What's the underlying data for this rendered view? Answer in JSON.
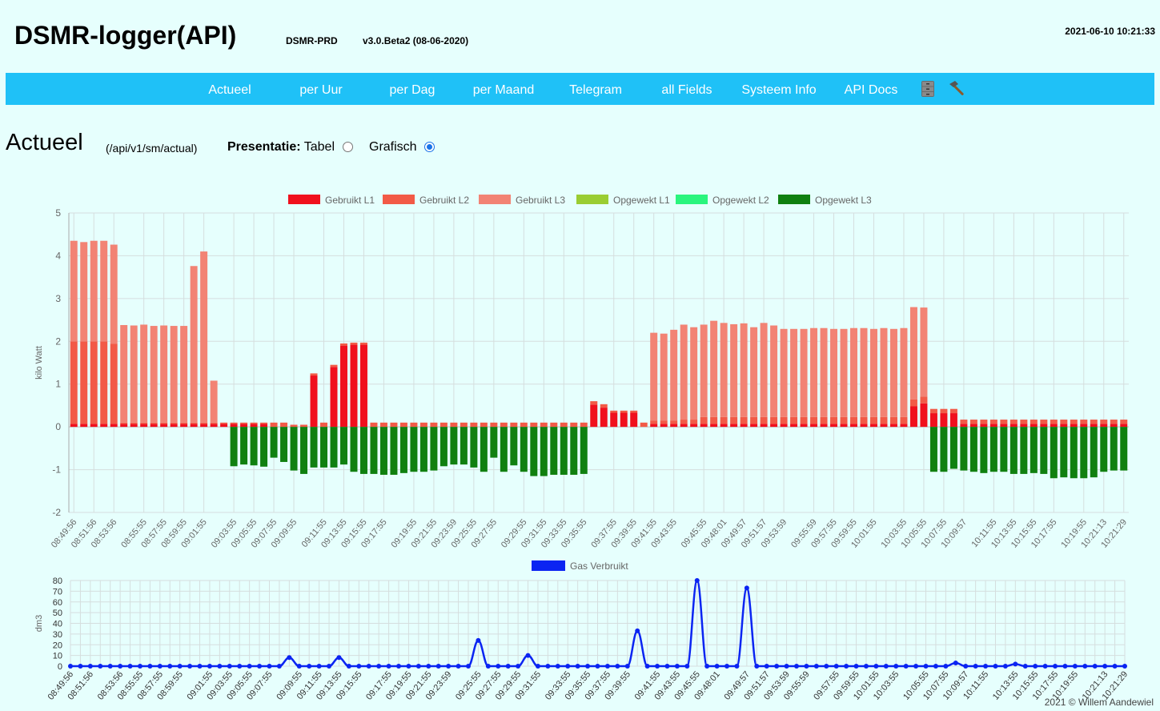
{
  "header": {
    "title": "DSMR-logger(API)",
    "host": "DSMR-PRD",
    "version": "v3.0.Beta2 (08-06-2020)",
    "datetime": "2021-06-10 10:21:33"
  },
  "nav": {
    "items": [
      "Actueel",
      "per Uur",
      "per Dag",
      "per Maand",
      "Telegram",
      "all Fields",
      "Systeem Info",
      "API Docs"
    ],
    "icons": [
      "file-cabinet-icon",
      "hammer-icon"
    ]
  },
  "page": {
    "title": "Actueel",
    "endpoint": "(/api/v1/sm/actual)",
    "presentatie_label": "Presentatie:",
    "option_tabel": "Tabel",
    "option_grafisch": "Grafisch",
    "selected": "Grafisch"
  },
  "colors": {
    "gebruikt_l1": "#f0101d",
    "gebruikt_l2": "#f25a47",
    "gebruikt_l3": "#f28374",
    "opgewekt_l1": "#9acd32",
    "opgewekt_l2": "#2af57d",
    "opgewekt_l3": "#108010",
    "gas": "#0b24f2",
    "navbar": "#1fc1f7",
    "background": "#e6fffd"
  },
  "chart_data": [
    {
      "type": "bar",
      "stacked": true,
      "ylabel": "kilo Watt",
      "ylim": [
        -2,
        5
      ],
      "yticks": [
        -2,
        -1,
        0,
        1,
        2,
        3,
        4,
        5
      ],
      "legend": [
        "Gebruikt L1",
        "Gebruikt L2",
        "Gebruikt L3",
        "Opgewekt L1",
        "Opgewekt L2",
        "Opgewekt L3"
      ],
      "legend_position": "top",
      "tick_labels": [
        "08:49:56",
        "08:51:56",
        "08:53:56",
        "08:55:55",
        "08:57:55",
        "08:59:55",
        "09:01:55",
        "09:03:55",
        "09:05:55",
        "09:07:55",
        "09:09:55",
        "09:11:55",
        "09:13:55",
        "09:15:55",
        "09:17:55",
        "09:19:55",
        "09:21:55",
        "09:23:59",
        "09:25:55",
        "09:27:55",
        "09:29:55",
        "09:31:55",
        "09:33:55",
        "09:35:55",
        "09:37:55",
        "09:39:55",
        "09:41:55",
        "09:43:55",
        "09:45:55",
        "09:48:01",
        "09:49:57",
        "09:51:57",
        "09:53:59",
        "09:55:59",
        "09:57:55",
        "09:59:55",
        "10:01:55",
        "10:03:55",
        "10:05:55",
        "10:07:55",
        "10:09:57",
        "10:11:55",
        "10:13:55",
        "10:15:55",
        "10:17:55",
        "10:19:55",
        "10:21:13",
        "10:21:29"
      ],
      "series": [
        {
          "name": "Gebruikt L1",
          "values": [
            0.07,
            0.07,
            0.07,
            0.07,
            0.07,
            0.07,
            0.07,
            0.07,
            0.07,
            0.07,
            0.07,
            0.07,
            0.07,
            0.07,
            0.07,
            0.07,
            0.07,
            0.07,
            0.07,
            0.07,
            0,
            0,
            0,
            0,
            1.2,
            0,
            1.4,
            1.9,
            1.92,
            1.92,
            0,
            0,
            0,
            0,
            0,
            0,
            0,
            0,
            0,
            0,
            0,
            0,
            0,
            0,
            0,
            0,
            0,
            0,
            0,
            0,
            0,
            0,
            0.52,
            0.45,
            0.33,
            0.33,
            0.33,
            0,
            0.07,
            0.07,
            0.07,
            0.07,
            0.07,
            0.07,
            0.07,
            0.07,
            0.07,
            0.07,
            0.07,
            0.07,
            0.07,
            0.07,
            0.07,
            0.07,
            0.07,
            0.07,
            0.07,
            0.07,
            0.07,
            0.07,
            0.07,
            0.07,
            0.07,
            0.07,
            0.48,
            0.55,
            0.32,
            0.32,
            0.32,
            0.07,
            0.07,
            0.07,
            0.07,
            0.07,
            0.07,
            0.07,
            0.07,
            0.07,
            0.07,
            0.07,
            0.07,
            0.07,
            0.07,
            0.07,
            0.07,
            0.07
          ]
        },
        {
          "name": "Gebruikt L2",
          "values": [
            1.93,
            1.93,
            1.93,
            1.93,
            1.87,
            0.03,
            0.03,
            0.03,
            0.03,
            0.03,
            0.03,
            0.03,
            0.03,
            0.03,
            0.03,
            0.03,
            0.03,
            0.03,
            0.03,
            0.03,
            0.1,
            0.1,
            0.05,
            0.05,
            0.05,
            0.1,
            0.05,
            0.05,
            0.05,
            0.05,
            0.1,
            0.1,
            0.1,
            0.1,
            0.1,
            0.1,
            0.1,
            0.1,
            0.1,
            0.1,
            0.1,
            0.1,
            0.1,
            0.1,
            0.1,
            0.1,
            0.1,
            0.1,
            0.1,
            0.1,
            0.1,
            0.1,
            0.08,
            0.08,
            0.05,
            0.05,
            0.05,
            0.1,
            0.08,
            0.08,
            0.08,
            0.1,
            0.1,
            0.16,
            0.16,
            0.16,
            0.16,
            0.16,
            0.16,
            0.16,
            0.16,
            0.16,
            0.16,
            0.16,
            0.16,
            0.16,
            0.16,
            0.16,
            0.16,
            0.16,
            0.16,
            0.16,
            0.16,
            0.16,
            0.16,
            0.16,
            0.1,
            0.1,
            0.1,
            0.1,
            0.1,
            0.1,
            0.1,
            0.1,
            0.1,
            0.1,
            0.1,
            0.1,
            0.1,
            0.1,
            0.1,
            0.1,
            0.1,
            0.1,
            0.1,
            0.1
          ]
        },
        {
          "name": "Gebruikt L3",
          "values": [
            2.35,
            2.32,
            2.35,
            2.35,
            2.32,
            2.28,
            2.27,
            2.29,
            2.26,
            2.27,
            2.26,
            2.26,
            3.66,
            4.0,
            0.98,
            0,
            0,
            0,
            0,
            0,
            0,
            0,
            0,
            0,
            0,
            0,
            0,
            0,
            0,
            0,
            0,
            0,
            0,
            0,
            0,
            0,
            0,
            0,
            0,
            0,
            0,
            0,
            0,
            0,
            0,
            0,
            0,
            0,
            0,
            0,
            0,
            0,
            0,
            0,
            0,
            0,
            0,
            0,
            2.05,
            2.03,
            2.12,
            2.22,
            2.16,
            2.16,
            2.25,
            2.2,
            2.17,
            2.19,
            2.1,
            2.2,
            2.14,
            2.06,
            2.06,
            2.06,
            2.08,
            2.08,
            2.06,
            2.06,
            2.08,
            2.08,
            2.06,
            2.08,
            2.06,
            2.08,
            2.16,
            2.08,
            0,
            0,
            0,
            0,
            0,
            0,
            0,
            0,
            0,
            0,
            0,
            0,
            0,
            0,
            0,
            0,
            0,
            0,
            0,
            0
          ]
        },
        {
          "name": "Opgewekt L1",
          "values": [
            0,
            0,
            0,
            0,
            0,
            0,
            0,
            0,
            0,
            0,
            0,
            0,
            0,
            0,
            0,
            0,
            0,
            0,
            0,
            0,
            0,
            0,
            0,
            0,
            0,
            0,
            0,
            0,
            0,
            0,
            0,
            0,
            0,
            0,
            0,
            0,
            0,
            0,
            0,
            0,
            0,
            0,
            0,
            0,
            0,
            0,
            0,
            0,
            0,
            0,
            0,
            0,
            0,
            0,
            0,
            0,
            0,
            0,
            0,
            0,
            0,
            0,
            0,
            0,
            0,
            0,
            0,
            0,
            0,
            0,
            0,
            0,
            0,
            0,
            0,
            0,
            0,
            0,
            0,
            0,
            0,
            0,
            0,
            0,
            0,
            0,
            0,
            0,
            0,
            0,
            0,
            0,
            0,
            0,
            0,
            0,
            0,
            0,
            0,
            0,
            0,
            0,
            0,
            0,
            0,
            0
          ]
        },
        {
          "name": "Opgewekt L2",
          "values": [
            0,
            0,
            0,
            0,
            0,
            0,
            0,
            0,
            0,
            0,
            0,
            0,
            0,
            0,
            0,
            0,
            0,
            0,
            0,
            0,
            0,
            0,
            0,
            0,
            0,
            0,
            0,
            0,
            0,
            0,
            0,
            0,
            0,
            0,
            0,
            0,
            0,
            0,
            0,
            0,
            0,
            0,
            0,
            0,
            0,
            0,
            0,
            0,
            0,
            0,
            0,
            0,
            0,
            0,
            0,
            0,
            0,
            0,
            0,
            0,
            0,
            0,
            0,
            0,
            0,
            0,
            0,
            0,
            0,
            0,
            0,
            0,
            0,
            0,
            0,
            0,
            0,
            0,
            0,
            0,
            0,
            0,
            0,
            0,
            0,
            0,
            0,
            0,
            0,
            0,
            0,
            0,
            0,
            0,
            0,
            0,
            0,
            0,
            0,
            0,
            0,
            0,
            0,
            0,
            0,
            0
          ]
        },
        {
          "name": "Opgewekt L3",
          "values": [
            0,
            0,
            0,
            0,
            0,
            0,
            0,
            0,
            0,
            0,
            0,
            0,
            0,
            0,
            0,
            0,
            -0.92,
            -0.88,
            -0.9,
            -0.93,
            -0.72,
            -0.82,
            -1.02,
            -1.1,
            -0.95,
            -0.95,
            -0.95,
            -0.88,
            -1.05,
            -1.1,
            -1.1,
            -1.12,
            -1.12,
            -1.08,
            -1.05,
            -1.05,
            -1.02,
            -0.92,
            -0.88,
            -0.88,
            -0.95,
            -1.05,
            -0.72,
            -1.05,
            -0.9,
            -1.05,
            -1.15,
            -1.15,
            -1.12,
            -1.12,
            -1.12,
            -1.1,
            0,
            0,
            0,
            0,
            0,
            0,
            0,
            0,
            0,
            0,
            0,
            0,
            0,
            0,
            0,
            0,
            0,
            0,
            0,
            0,
            0,
            0,
            0,
            0,
            0,
            0,
            0,
            0,
            0,
            0,
            0,
            0,
            0,
            0,
            -1.05,
            -1.05,
            -0.98,
            -1.02,
            -1.05,
            -1.08,
            -1.05,
            -1.05,
            -1.1,
            -1.1,
            -1.08,
            -1.1,
            -1.2,
            -1.18,
            -1.2,
            -1.2,
            -1.18,
            -1.05,
            -1.02,
            -1.02
          ]
        }
      ]
    },
    {
      "type": "line",
      "ylabel": "dm3",
      "ylim": [
        0,
        80
      ],
      "yticks": [
        0,
        10,
        20,
        30,
        40,
        50,
        60,
        70,
        80
      ],
      "legend": [
        "Gas Verbruikt"
      ],
      "legend_position": "top",
      "tick_labels": [
        "08:49:56",
        "08:51:56",
        "08:53:56",
        "08:55:55",
        "08:57:55",
        "08:59:55",
        "09:01:55",
        "09:03:55",
        "09:05:55",
        "09:07:55",
        "09:09:55",
        "09:11:55",
        "09:13:55",
        "09:15:55",
        "09:17:55",
        "09:19:55",
        "09:21:55",
        "09:23:59",
        "09:25:55",
        "09:27:55",
        "09:29:55",
        "09:31:55",
        "09:33:55",
        "09:35:55",
        "09:37:55",
        "09:39:55",
        "09:41:55",
        "09:43:55",
        "09:45:55",
        "09:48:01",
        "09:49:57",
        "09:51:57",
        "09:53:59",
        "09:55:59",
        "09:57:55",
        "09:59:55",
        "10:01:55",
        "10:03:55",
        "10:05:55",
        "10:07:55",
        "10:09:57",
        "10:11:55",
        "10:13:55",
        "10:15:55",
        "10:17:55",
        "10:19:55",
        "10:21:13",
        "10:21:29"
      ],
      "series": [
        {
          "name": "Gas Verbruikt",
          "values": [
            0,
            0,
            0,
            0,
            0,
            0,
            0,
            0,
            0,
            0,
            0,
            0,
            0,
            0,
            0,
            0,
            0,
            0,
            0,
            0,
            0,
            0,
            8,
            0,
            0,
            0,
            0,
            8,
            0,
            0,
            0,
            0,
            0,
            0,
            0,
            0,
            0,
            0,
            0,
            0,
            0,
            24,
            0,
            0,
            0,
            0,
            10,
            0,
            0,
            0,
            0,
            0,
            0,
            0,
            0,
            0,
            0,
            33,
            0,
            0,
            0,
            0,
            0,
            80,
            0,
            0,
            0,
            0,
            73,
            0,
            0,
            0,
            0,
            0,
            0,
            0,
            0,
            0,
            0,
            0,
            0,
            0,
            0,
            0,
            0,
            0,
            0,
            0,
            0,
            3,
            0,
            0,
            0,
            0,
            0,
            2,
            0,
            0,
            0,
            0,
            0,
            0,
            0,
            0,
            0,
            0,
            0
          ]
        }
      ]
    }
  ],
  "footer": {
    "text": "2021 © Willem Aandewiel"
  }
}
